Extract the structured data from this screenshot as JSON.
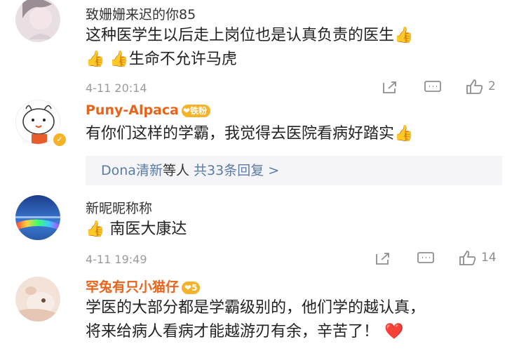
{
  "comments": [
    {
      "name": "致姗姗来迟的你85",
      "content_line1": "这种医学生以后走上岗位也是认真负责的医生",
      "content_line2": "生命不允许马虎",
      "time": "4-11 20:14",
      "likes": "2"
    },
    {
      "name": "Puny-Alpaca",
      "badge_label": "铁粉",
      "content_line1": "有你们这样的学霸，我觉得去医院看病好踏实",
      "reply_users": "Dona清新",
      "reply_mid": "等人",
      "reply_total": "共33条回复 >"
    },
    {
      "name": "新昵昵称称",
      "content_line1": "南医大康达",
      "time": "4-11 19:49",
      "likes": "14"
    },
    {
      "name": "罕兔有只小猫仔",
      "badge_label": "5",
      "content_line1": "学医的大部分都是学霸级别的，他们学的越认真，",
      "content_line2": "将来给病人看病才能越游刃有余，辛苦了！"
    }
  ],
  "icons": {
    "thumbs_emoji": "thumbs-up-emoji",
    "heart_emoji": "red-heart-emoji",
    "share": "share-icon",
    "comment": "comment-icon",
    "like": "like-icon"
  },
  "colors": {
    "vip_name": "#e8641b",
    "link": "#5a7aa8",
    "meta": "#9b9b9b",
    "badge": "#f6b32a"
  }
}
